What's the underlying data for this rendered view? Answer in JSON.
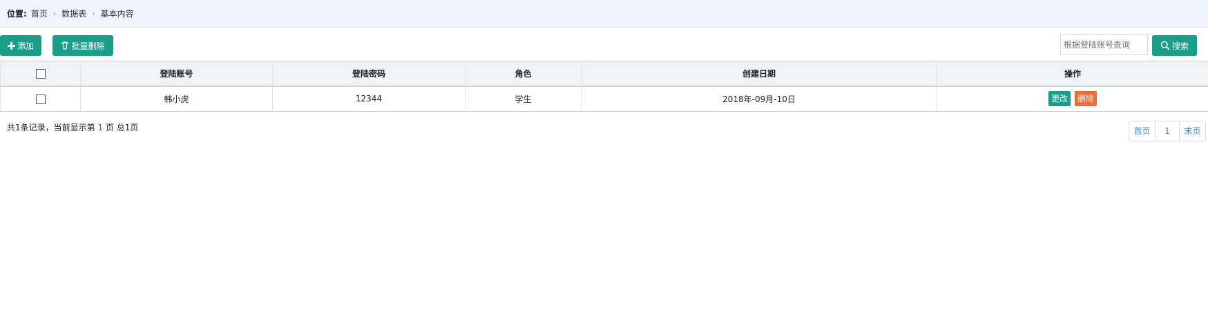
{
  "breadcrumb": {
    "label": "位置:",
    "items": [
      "首页",
      "数据表",
      "基本内容"
    ]
  },
  "toolbar": {
    "add_label": "添加",
    "bulk_delete_label": "批量删除",
    "search_placeholder": "根据登陆账号查询",
    "search_value": "",
    "search_label": "搜索"
  },
  "table": {
    "columns": [
      "登陆账号",
      "登陆密码",
      "角色",
      "创建日期",
      "操作"
    ],
    "rows": [
      {
        "account": "韩小虎",
        "password": "12344",
        "role": "学生",
        "created": "2018年-09月-10日",
        "edit_label": "更改",
        "delete_label": "删除"
      }
    ]
  },
  "summary": {
    "prefix": "共1条记录，当前显示第",
    "current_page": "1",
    "suffix": "页 总1页"
  },
  "pager": {
    "first": "首页",
    "page": "1",
    "last": "末页"
  },
  "colors": {
    "primary": "#1a9e8a",
    "danger": "#f06a3b",
    "link": "#2f8fd0",
    "breadcrumb_bg": "#eef5fc"
  },
  "icons": {
    "add": "plus-icon",
    "bulk_delete": "trash-icon",
    "search": "search-icon",
    "separator": "chevron-right-icon"
  }
}
